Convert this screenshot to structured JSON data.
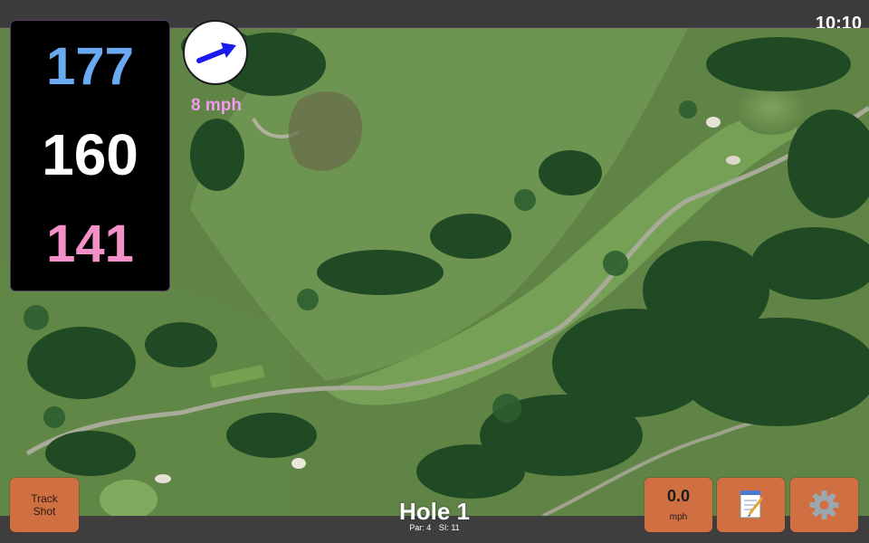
{
  "status_bar": {
    "time": "10:10"
  },
  "yardage": {
    "back": "177",
    "middle": "160",
    "front": "141"
  },
  "wind": {
    "speed": "8 mph",
    "direction_icon": "arrow-up-right-icon"
  },
  "buttons": {
    "track_shot_label": "Track\nShot",
    "speed_value": "0.0",
    "speed_unit": "mph",
    "notes_icon": "notepad-icon",
    "settings_icon": "gear-icon"
  },
  "hole": {
    "title": "Hole 1",
    "par": "Par: 4",
    "si": "SI: 11"
  },
  "colors": {
    "back_yardage": "#6aaaf2",
    "middle_yardage": "#ffffff",
    "front_yardage": "#f490c8",
    "button_orange": "#cf6f42",
    "wind_text": "#f29af0"
  }
}
